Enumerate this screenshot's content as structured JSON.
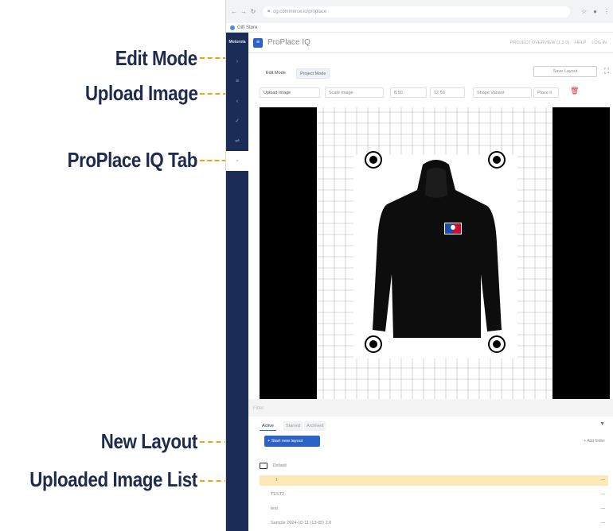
{
  "callouts": {
    "edit_mode": "Edit Mode",
    "upload_image": "Upload Image",
    "proplace_tab": "ProPlace IQ Tab",
    "new_layout": "New Layout",
    "uploaded_image_list": "Uploaded Image List"
  },
  "browser": {
    "url": "cg.commerce.io/proplace",
    "bookmark": "Gift Store"
  },
  "sidebar": {
    "brand": "Motorola",
    "items": [
      "›",
      "≡",
      "‹",
      "✓",
      "⇌",
      "▫"
    ]
  },
  "header": {
    "title": "ProPlace IQ",
    "right_items": [
      "PROJECT OVERVIEW (1.3.0)",
      "HELP",
      "LOG IN"
    ]
  },
  "modes": {
    "edit": "Edit Mode",
    "project": "Project Mode",
    "save": "Save Layout"
  },
  "toolbar": {
    "upload": "Upload Image",
    "scale": "Scale Image",
    "width": "8.50",
    "height": "12.50",
    "shape": "Shape Variant",
    "place": "Place it",
    "trash_icon": "trash-icon"
  },
  "bottom": {
    "filter_placeholder": "Filter",
    "tabs": [
      "Active",
      "Starred",
      "Archived"
    ],
    "new_layout": "+ Start new layout",
    "add_folder": "+ Add folder",
    "tree": [
      "Default",
      "1",
      "TEST2",
      "test",
      "Sample 2024-10-11 (13-05) 2.0"
    ]
  },
  "colors": {
    "sidebar": "#1b2d57",
    "accent": "#2a63c4",
    "callout_text": "#1f2b4d",
    "callout_line": "#f0a30a"
  }
}
